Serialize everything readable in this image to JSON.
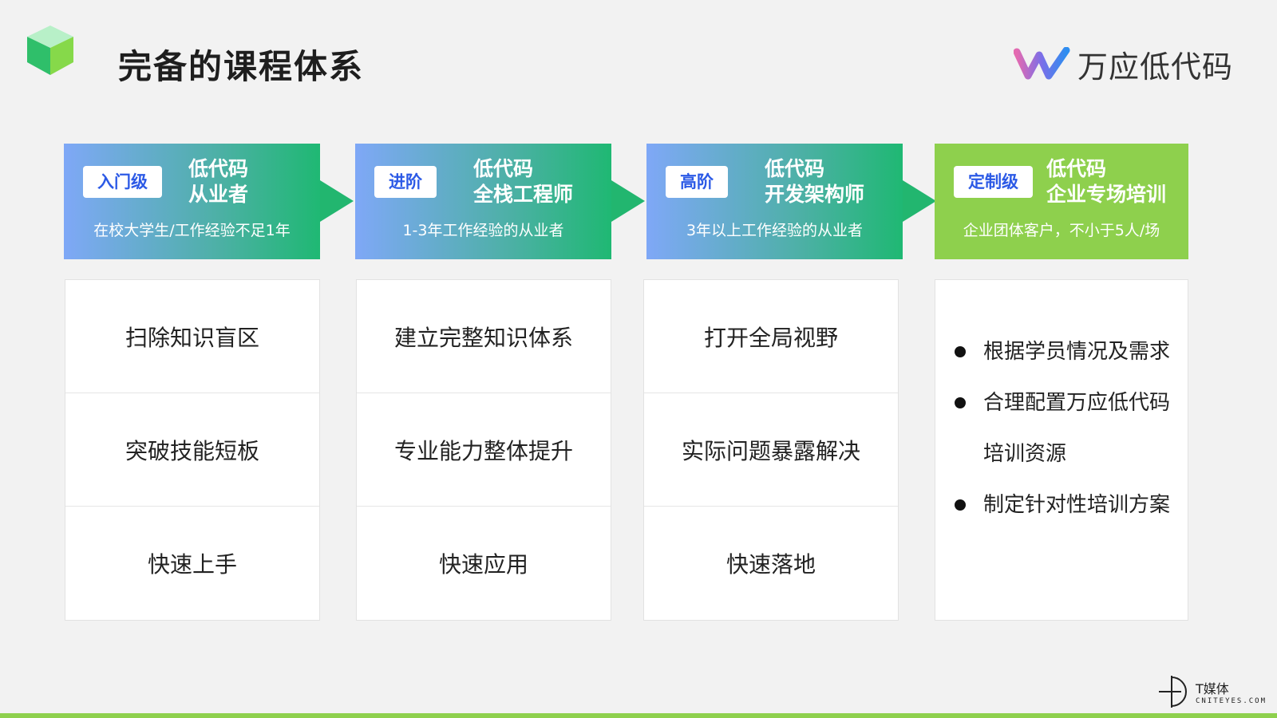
{
  "header": {
    "title": "完备的课程体系",
    "brand_name": "万应低代码"
  },
  "columns": [
    {
      "badge": "入门级",
      "title_line1": "低代码",
      "title_line2": "从业者",
      "subtitle": "在校大学生/工作经验不足1年",
      "items": [
        "扫除知识盲区",
        "突破技能短板",
        "快速上手"
      ]
    },
    {
      "badge": "进阶",
      "title_line1": "低代码",
      "title_line2": "全栈工程师",
      "subtitle": "1-3年工作经验的从业者",
      "items": [
        "建立完整知识体系",
        "专业能力整体提升",
        "快速应用"
      ]
    },
    {
      "badge": "高阶",
      "title_line1": "低代码",
      "title_line2": "开发架构师",
      "subtitle": "3年以上工作经验的从业者",
      "items": [
        "打开全局视野",
        "实际问题暴露解决",
        "快速落地"
      ]
    },
    {
      "badge": "定制级",
      "title_line1": "低代码",
      "title_line2": "企业专场培训",
      "subtitle": "企业团体客户，不小于5人/场",
      "bullets": [
        "根据学员情况及需求",
        "合理配置万应低代码培训资源",
        "制定针对性培训方案"
      ]
    }
  ],
  "footer": {
    "watermark_cn": "T媒体",
    "watermark_en": "CNITEYES.COM"
  },
  "colors": {
    "head_gradient_start": "#7fa8f7",
    "head_gradient_end": "#1fb873",
    "custom_head": "#8ed04d",
    "badge_text": "#2c5ae6"
  }
}
